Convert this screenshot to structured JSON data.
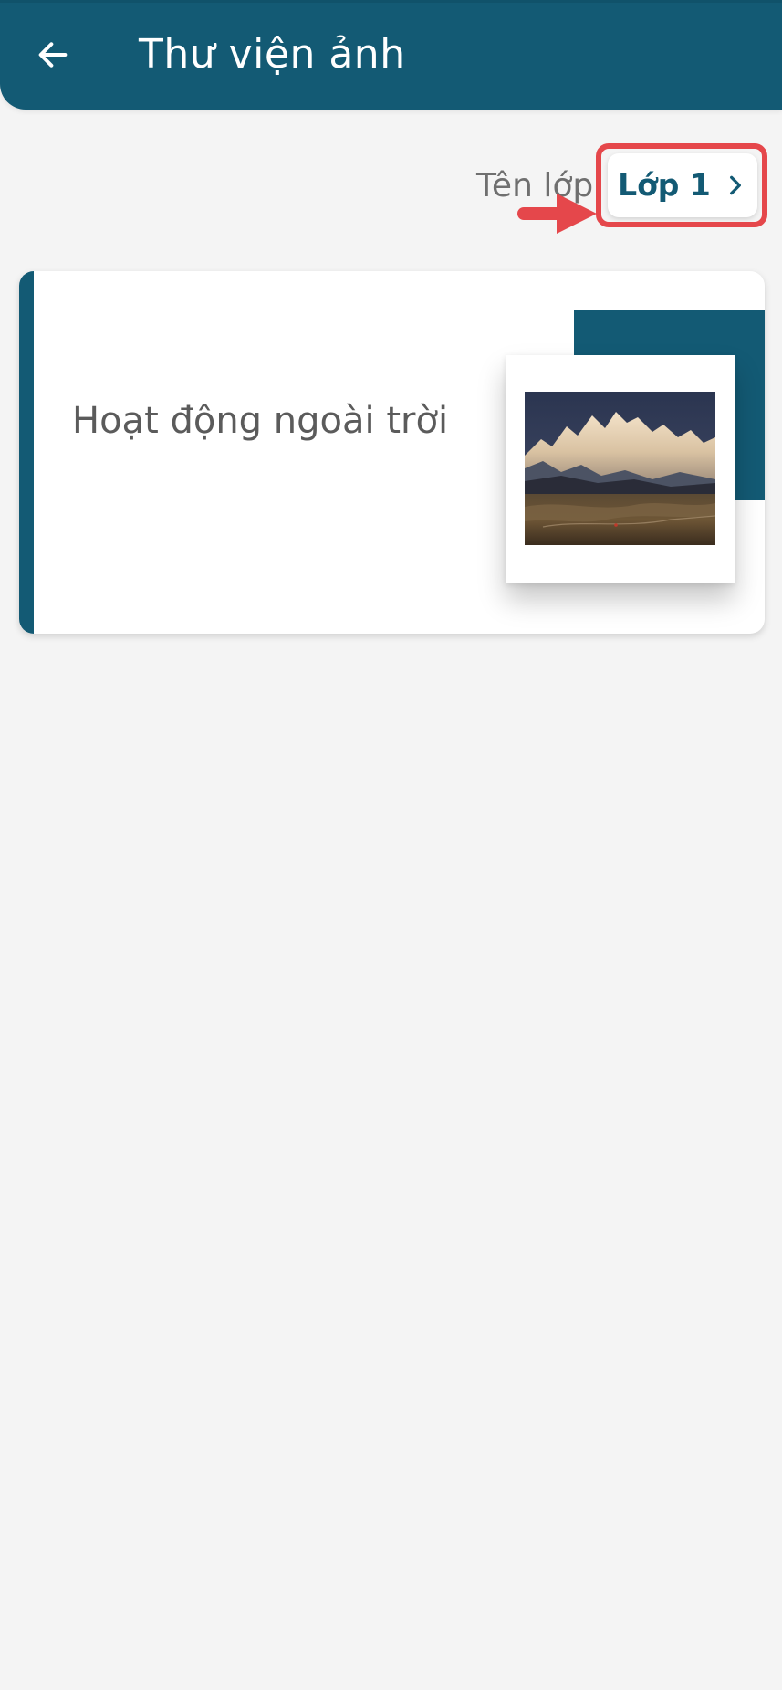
{
  "header": {
    "title": "Thư viện ảnh",
    "back_icon": "arrow-left-icon",
    "background_color": "#135a74"
  },
  "class_filter": {
    "label": "Tên lớp",
    "selected_value": "Lớp 1",
    "chevron_icon": "chevron-right-icon"
  },
  "albums": [
    {
      "title": "Hoạt động ngoài trời",
      "thumbnail": "mountain-landscape-photo",
      "accent_color": "#135a74"
    }
  ],
  "annotation": {
    "highlight_color": "#e5474b"
  }
}
